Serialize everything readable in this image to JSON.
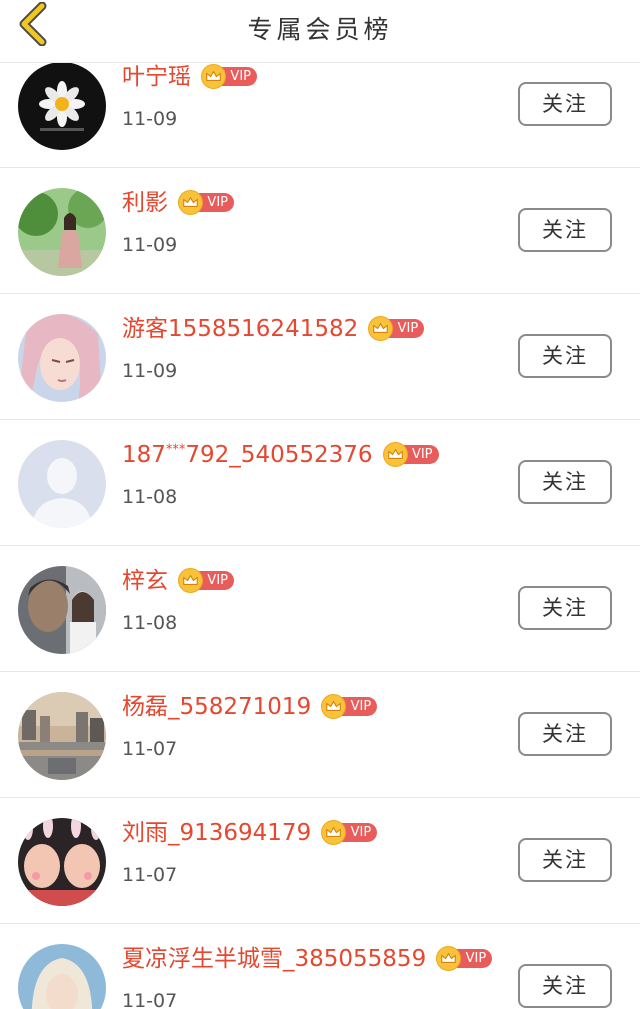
{
  "header": {
    "title": "专属会员榜",
    "back_icon_color": "#f2c81f"
  },
  "colors": {
    "name": "#e5472f",
    "vip_pill": "#e85d5b",
    "crown": "#f8c23a"
  },
  "vip_label": "VIP",
  "follow_label": "关注",
  "members": [
    {
      "name": "叶宁瑶",
      "date": "11-09",
      "avatar": "daisy-on-black"
    },
    {
      "name": "利影",
      "date": "11-09",
      "avatar": "woman-in-park"
    },
    {
      "name": "游客1558516241582",
      "date": "11-09",
      "avatar": "anime-character"
    },
    {
      "name_prefix": "187",
      "name_sup": "***",
      "name_suffix": "792_540552376",
      "date": "11-08",
      "avatar": "default-silhouette"
    },
    {
      "name": "梓玄",
      "date": "11-08",
      "avatar": "couple-photo"
    },
    {
      "name": "杨磊_558271019",
      "date": "11-07",
      "avatar": "canal-town"
    },
    {
      "name": "刘雨_913694179",
      "date": "11-07",
      "avatar": "two-girls-bunny-ears"
    },
    {
      "name": "夏凉浮生半城雪_385055859",
      "date": "11-07",
      "avatar": "blonde-character"
    }
  ]
}
